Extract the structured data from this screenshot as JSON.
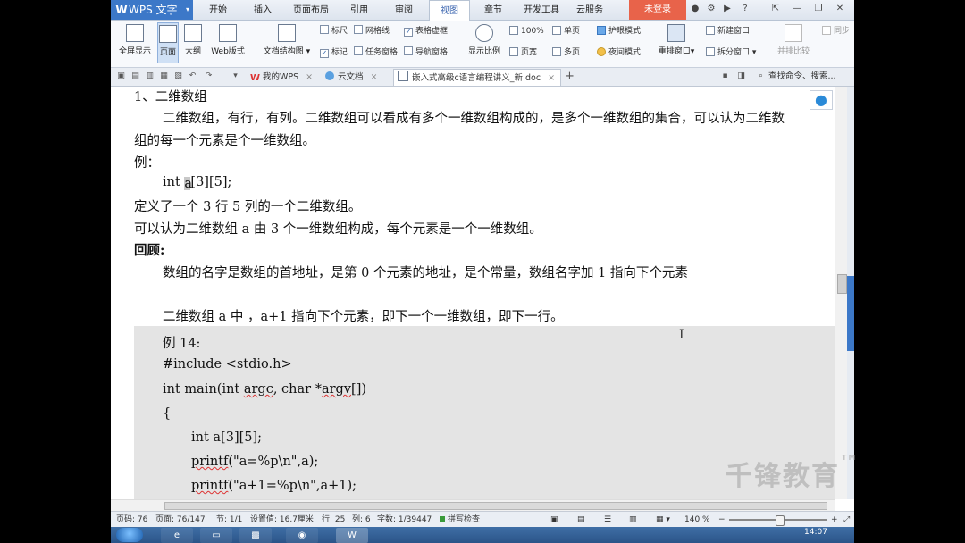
{
  "app": {
    "name": "WPS 文字"
  },
  "menu": {
    "tabs": [
      "开始",
      "插入",
      "页面布局",
      "引用",
      "审阅",
      "视图",
      "章节",
      "开发工具",
      "云服务"
    ],
    "active_tab": "视图",
    "login_label": "未登录",
    "help_label": "?"
  },
  "ribbon": {
    "fullscreen": "全屏显示",
    "page": "页面",
    "outline": "大纲",
    "web_layout": "Web版式",
    "doc_structure": "文档结构图",
    "ruler": "标尺",
    "gridlines": "网格线",
    "table_gridlines": "表格虚框",
    "marks": "标记",
    "task_pane": "任务窗格",
    "nav_pane": "导航窗格",
    "zoom_ratio": "显示比例",
    "zoom_100": "100%",
    "page_width": "页宽",
    "single_page": "单页",
    "multi_page": "多页",
    "eye_mode": "护眼模式",
    "night_mode": "夜间模式",
    "rearrange": "重排窗口",
    "new_window": "新建窗口",
    "split_window": "拆分窗口",
    "side_by_side": "并排比较",
    "sync": "同步"
  },
  "doc_tabs": {
    "my_wps": "我的WPS",
    "cloud_docs": "云文档",
    "active_doc": "嵌入式高级c语言编程讲义_新.doc",
    "search_placeholder": "查找命令、搜索..."
  },
  "document": {
    "heading": "1、二维数组",
    "p1": "二维数组，有行，有列。二维数组可以看成有多个一维数组构成的，是多个一维数组的集合，可以认为二维数",
    "p1_cont": "组的每一个元素是个一维数组。",
    "example_label": "例：",
    "code_int": "int ",
    "code_a": "a",
    "code_rest": "[3][5];",
    "def_line": "定义了一个 3 行 5 列的一个二维数组。",
    "consider_line": "可以认为二维数组 a 由 3 个一维数组构成，每个元素是一个一维数组。",
    "review_label": "回顾:",
    "review_text": "数组的名字是数组的首地址，是第 0 个元素的地址，是个常量，数组名字加 1 指向下个元素",
    "a_plus_1": "二维数组 a 中 ，a+1  指向下个元素，即下一个一维数组，即下一行。",
    "example14": "例 14:",
    "include": "#include <stdio.h>",
    "main_pre": "int main(int ",
    "argc": "argc",
    "main_mid": ", char *",
    "argv": "argv",
    "main_post": "[])",
    "brace": "{",
    "decl": "int a[3][5];",
    "printf1_fn": "printf",
    "printf1_args": "(\"a=%p\\n\",a);",
    "printf2_fn": "printf",
    "printf2_args": "(\"a+1=%p\\n\",a+1);"
  },
  "status": {
    "page_num": "页码: 76",
    "pages": "页面: 76/147",
    "section": "节: 1/1",
    "setting": "设置值: 16.7厘米",
    "row": "行: 25",
    "col": "列: 6",
    "wordcount": "字数: 1/39447",
    "spellcheck": "拼写检查",
    "zoom": "140 %"
  },
  "taskbar": {
    "time": "14:07"
  },
  "watermark": {
    "text": "千锋教育",
    "tm": "TM"
  },
  "colors": {
    "accent": "#3c78c8",
    "login": "#e8634a",
    "code_bg": "#e4e4e4"
  }
}
